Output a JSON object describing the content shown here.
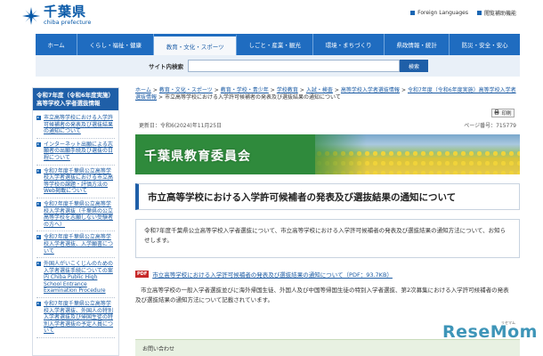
{
  "header": {
    "logo_title": "千葉県",
    "logo_sub": "chiba prefecture",
    "links": [
      {
        "label": "Foreign Languages"
      },
      {
        "label": "閲覧補助機能"
      }
    ]
  },
  "gnav": {
    "items": [
      {
        "label": "ホーム"
      },
      {
        "label": "くらし・福祉・健康"
      },
      {
        "label": "教育・文化・スポーツ"
      },
      {
        "label": "しごと・産業・観光"
      },
      {
        "label": "環境・まちづくり"
      },
      {
        "label": "県政情報・統計"
      },
      {
        "label": "防災・安全・安心"
      }
    ],
    "active_index": 2
  },
  "search": {
    "label": "サイト内検索",
    "value": "",
    "button": "検索"
  },
  "sidebar": {
    "heading": "令和7年度（令和6年度実施）高等学校入学者選抜情報",
    "items": [
      {
        "label": "市立高等学校における入学許可候補者の発表及び選抜結果の通知について"
      },
      {
        "label": "インターネット出願による志願者の出願手続及び選抜の日程について"
      },
      {
        "label": "令和7年度千葉県公立高等学校入学者選抜における市立高等学校の課題・評価方法のWeb掲載について"
      },
      {
        "label": "令和7年度千葉県公立高等学校入学者選抜（千葉県の公立高等学校を志願しない受験者の方へ）"
      },
      {
        "label": "令和7年度千葉県公立高等学校入学者選抜、入学願書について"
      },
      {
        "label": "外国人がいこくじんのための入学者選抜手続についての案内 Chiba Public High School Entrance Examination Procedure"
      },
      {
        "label": "令和7年度千葉県公立高等学校入学者選抜、外国人の特別入学者選抜及び帰国生徒の特別入学者選抜の予定人員について"
      }
    ]
  },
  "breadcrumb": {
    "items": [
      {
        "label": "ホーム"
      },
      {
        "label": "教育・文化・スポーツ"
      },
      {
        "label": "教育・学校・青少年"
      },
      {
        "label": "学校教育"
      },
      {
        "label": "入試・検査"
      },
      {
        "label": "高等学校入学者選抜情報"
      },
      {
        "label": "令和7年度（令和6年度実施）高等学校入学者選抜情報"
      }
    ],
    "current": "市立高等学校における入学許可候補者の発表及び選抜結果の通知について"
  },
  "print_label": "印刷",
  "meta": {
    "updated": "更新日：令和6(2024)年11月25日",
    "page_number": "ページ番号：715779"
  },
  "banner": {
    "title": "千葉県教育委員会"
  },
  "page_title": "市立高等学校における入学許可候補者の発表及び選抜結果の通知について",
  "lead": "令和7年度千葉県公立高等学校入学者選抜について、市立高等学校における入学許可候補者の発表及び選抜結果の通知方法について、お知らせします。",
  "pdf": {
    "icon": "PDF",
    "link": "市立高等学校における入学許可候補者の発表及び選抜結果の通知について（PDF：93.7KB）"
  },
  "body": "市立高等学校の一般入学者選抜並びに海外帰国生徒、外国人及び中国等帰国生徒の特別入学者選抜、第2次募集における入学許可候補者の発表及び選抜結果の通知方法について記載されています。",
  "contact_heading": "お問い合わせ",
  "watermark": {
    "text": "ReseMom",
    "sub": "リセマム"
  },
  "colors": {
    "brand_blue": "#1f6cc0",
    "banner_green": "#2f8a3c"
  }
}
